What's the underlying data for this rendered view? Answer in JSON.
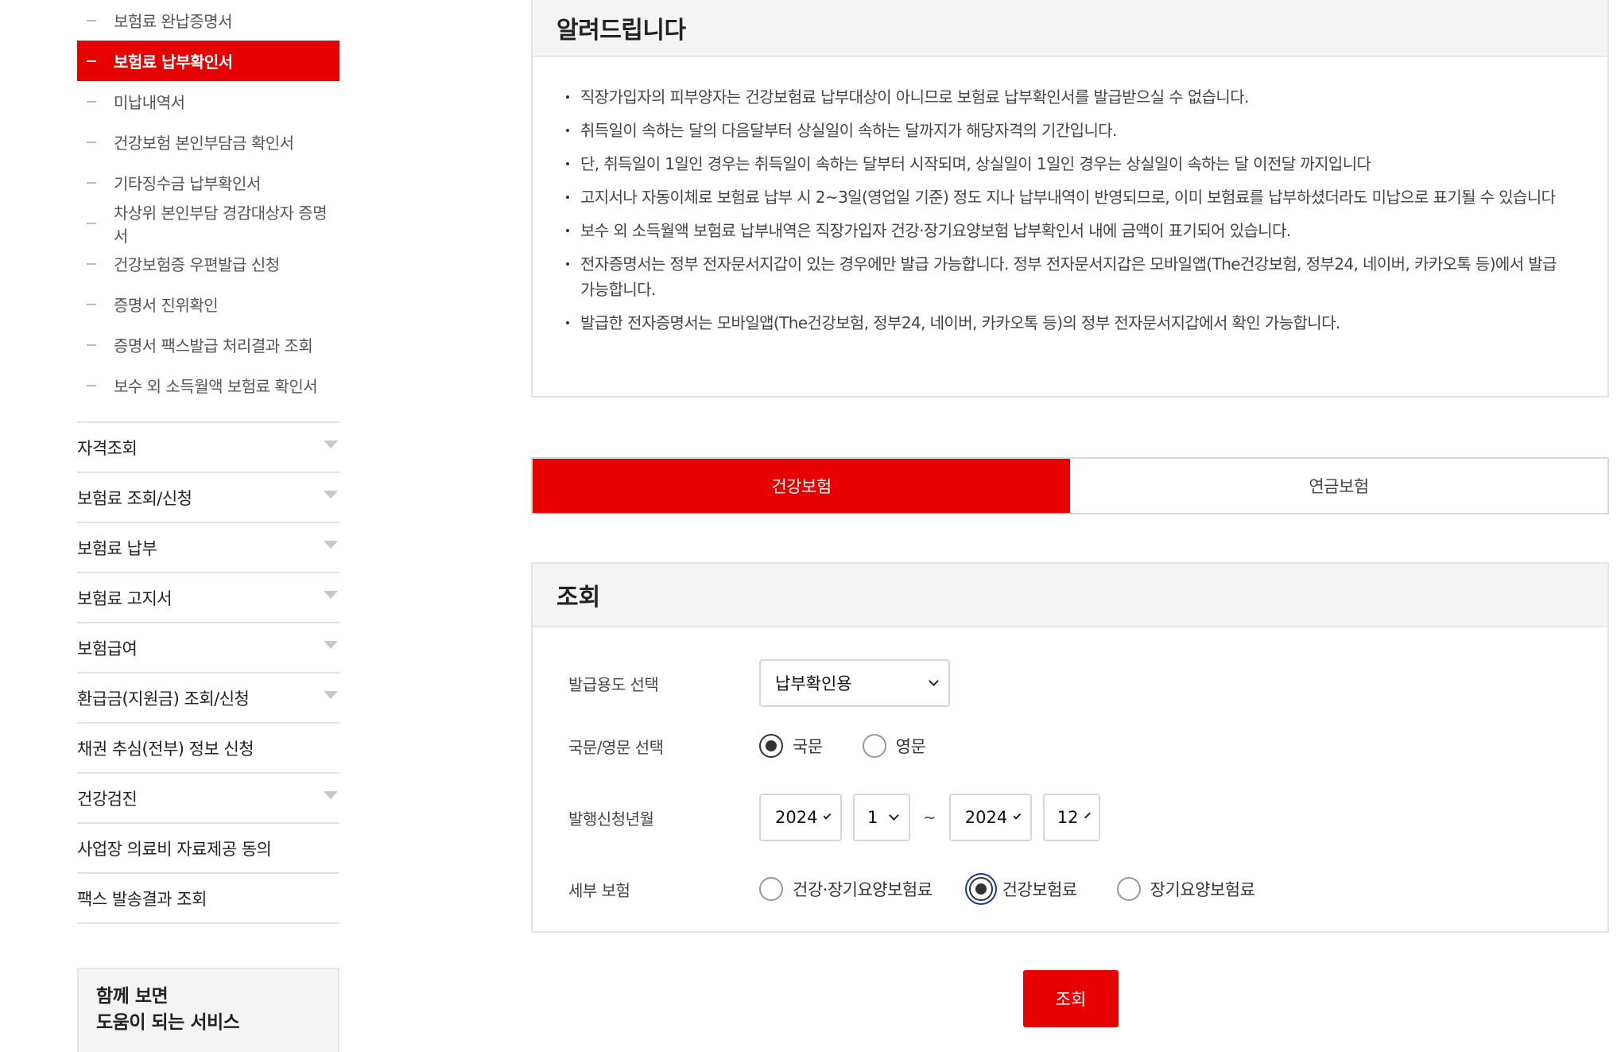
{
  "sidebar": {
    "sub_items": [
      {
        "label": "보험료 완납증명서",
        "active": false
      },
      {
        "label": "보험료 납부확인서",
        "active": true
      },
      {
        "label": "미납내역서",
        "active": false
      },
      {
        "label": "건강보험 본인부담금 확인서",
        "active": false
      },
      {
        "label": "기타징수금 납부확인서",
        "active": false
      },
      {
        "label": "차상위 본인부담 경감대상자 증명서",
        "active": false
      },
      {
        "label": "건강보험증 우편발급 신청",
        "active": false
      },
      {
        "label": "증명서 진위확인",
        "active": false
      },
      {
        "label": "증명서 팩스발급 처리결과 조회",
        "active": false
      },
      {
        "label": "보수 외 소득월액 보험료 확인서",
        "active": false
      }
    ],
    "main_items": [
      {
        "label": "자격조회",
        "has_caret": true
      },
      {
        "label": "보험료 조회/신청",
        "has_caret": true
      },
      {
        "label": "보험료 납부",
        "has_caret": true
      },
      {
        "label": "보험료 고지서",
        "has_caret": true
      },
      {
        "label": "보험급여",
        "has_caret": true
      },
      {
        "label": "환급금(지원금) 조회/신청",
        "has_caret": true
      },
      {
        "label": "채권 추심(전부) 정보 신청",
        "has_caret": false
      },
      {
        "label": "건강검진",
        "has_caret": true
      },
      {
        "label": "사업장 의료비 자료제공 동의",
        "has_caret": false
      },
      {
        "label": "팩스 발송결과 조회",
        "has_caret": false
      }
    ],
    "related": {
      "line1": "함께 보면",
      "line2": "도움이 되는 서비스"
    }
  },
  "notice": {
    "title": "알려드립니다",
    "items": [
      "직장가입자의 피부양자는 건강보험료 납부대상이 아니므로 보험료 납부확인서를 발급받으실 수 없습니다.",
      "취득일이 속하는 달의 다음달부터 상실일이 속하는 달까지가 해당자격의 기간입니다.",
      "단, 취득일이 1일인 경우는 취득일이 속하는 달부터 시작되며, 상실일이 1일인 경우는 상실일이 속하는 달 이전달 까지입니다",
      "고지서나 자동이체로 보험료 납부 시 2~3일(영업일 기준) 정도 지나 납부내역이 반영되므로, 이미 보험료를 납부하셨더라도 미납으로 표기될 수 있습니다",
      "보수 외 소득월액 보험료 납부내역은 직장가입자 건강·장기요양보험 납부확인서 내에 금액이 표기되어 있습니다.",
      "전자증명서는 정부 전자문서지갑이 있는 경우에만 발급 가능합니다. 정부 전자문서지갑은 모바일앱(The건강보험, 정부24, 네이버, 카카오톡 등)에서 발급 가능합니다.",
      "발급한 전자증명서는 모바일앱(The건강보험, 정부24, 네이버, 카카오톡 등)의 정부 전자문서지갑에서 확인 가능합니다."
    ]
  },
  "tabs": [
    {
      "label": "건강보험",
      "active": true
    },
    {
      "label": "연금보험",
      "active": false
    }
  ],
  "search": {
    "title": "조회",
    "purpose": {
      "label": "발급용도 선택",
      "value": "납부확인용"
    },
    "language": {
      "label": "국문/영문 선택",
      "options": [
        {
          "label": "국문",
          "checked": true
        },
        {
          "label": "영문",
          "checked": false
        }
      ]
    },
    "period": {
      "label": "발행신청년월",
      "from_year": "2024",
      "from_month": "1",
      "separator": "~",
      "to_year": "2024",
      "to_month": "12"
    },
    "detail": {
      "label": "세부 보험",
      "options": [
        {
          "label": "건강·장기요양보험료",
          "checked": false
        },
        {
          "label": "건강보험료",
          "checked": true
        },
        {
          "label": "장기요양보험료",
          "checked": false
        }
      ]
    },
    "submit_label": "조회"
  },
  "colors": {
    "accent": "#e60000",
    "panel_bg": "#f4f4f4",
    "border": "#e4e4e4"
  }
}
